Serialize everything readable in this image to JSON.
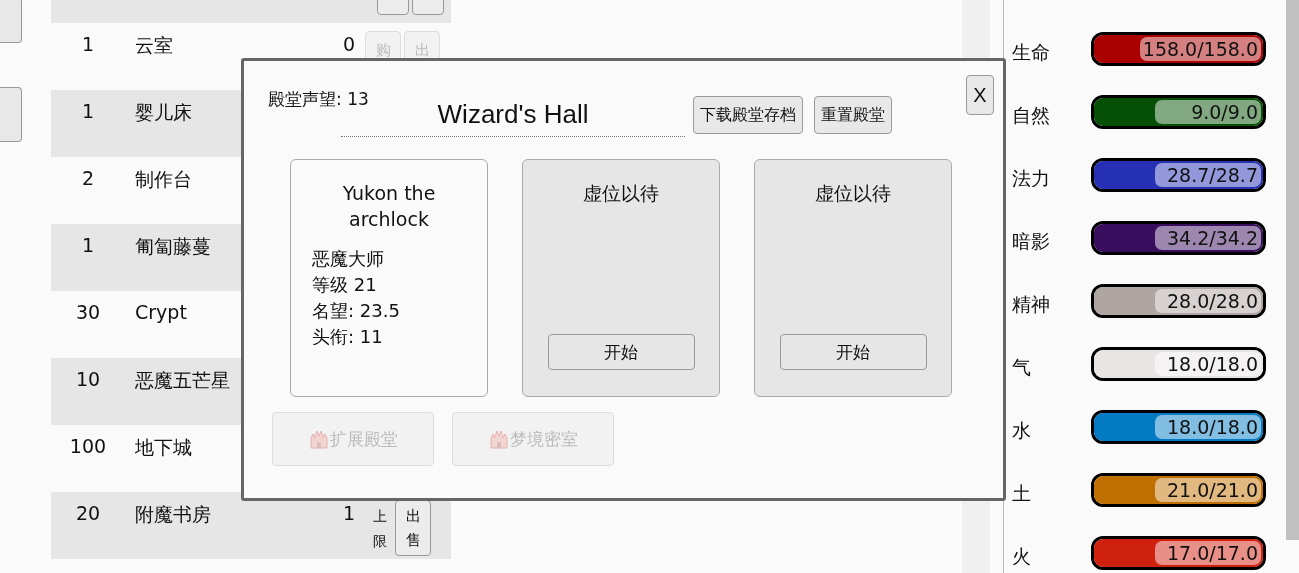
{
  "side_buttons": [
    {
      "kind": "button"
    },
    {
      "kind": "button"
    }
  ],
  "table": {
    "header_buttons": [
      {
        "kind": "button"
      },
      {
        "kind": "button"
      }
    ],
    "rows": [
      {
        "count": "1",
        "name": "云室",
        "value": "0",
        "actions": [
          {
            "label": "购",
            "disabled": true
          },
          {
            "label": "出",
            "disabled": true
          }
        ]
      },
      {
        "count": "1",
        "name": "婴儿床"
      },
      {
        "count": "2",
        "name": "制作台"
      },
      {
        "count": "1",
        "name": "匍匐藤蔓"
      },
      {
        "count": "30",
        "name": "Crypt"
      },
      {
        "count": "10",
        "name": "恶魔五芒星"
      },
      {
        "count": "100",
        "name": "地下城"
      },
      {
        "count": "20",
        "name": "附魔书房",
        "value": "1",
        "note": "上限",
        "actions": [
          {
            "label": "出售",
            "disabled": false
          }
        ]
      }
    ]
  },
  "dialog": {
    "prestige": "殿堂声望: 13",
    "title": "Wizard's Hall",
    "header_buttons": [
      "下载殿堂存档",
      "重置殿堂"
    ],
    "close": "X",
    "slots": [
      {
        "kind": "hero",
        "name": "Yukon the archlock",
        "lines": [
          "恶魔大师",
          "等级 21",
          "名望: 23.5",
          "头衔: 11"
        ]
      },
      {
        "kind": "empty",
        "name": "虚位以待",
        "button": "开始"
      },
      {
        "kind": "empty",
        "name": "虚位以待",
        "button": "开始"
      }
    ],
    "footer_buttons": [
      {
        "label": "扩展殿堂",
        "disabled": true
      },
      {
        "label": "梦境密室",
        "disabled": true
      }
    ]
  },
  "stats": [
    {
      "label": "生命",
      "reading": "158.0/158.0",
      "color": "#aa0000"
    },
    {
      "label": "自然",
      "reading": "9.0/9.0",
      "color": "#055005"
    },
    {
      "label": "法力",
      "reading": "28.7/28.7",
      "color": "#2530b5"
    },
    {
      "label": "暗影",
      "reading": "34.2/34.2",
      "color": "#3a0e5e"
    },
    {
      "label": "精神",
      "reading": "28.0/28.0",
      "color": "#aea4a2"
    },
    {
      "label": "气",
      "reading": "18.0/18.0",
      "color": "#e9e5e4"
    },
    {
      "label": "水",
      "reading": "18.0/18.0",
      "color": "#057ac4"
    },
    {
      "label": "土",
      "reading": "21.0/21.0",
      "color": "#c07000"
    },
    {
      "label": "火",
      "reading": "17.0/17.0",
      "color": "#d0200e"
    }
  ]
}
